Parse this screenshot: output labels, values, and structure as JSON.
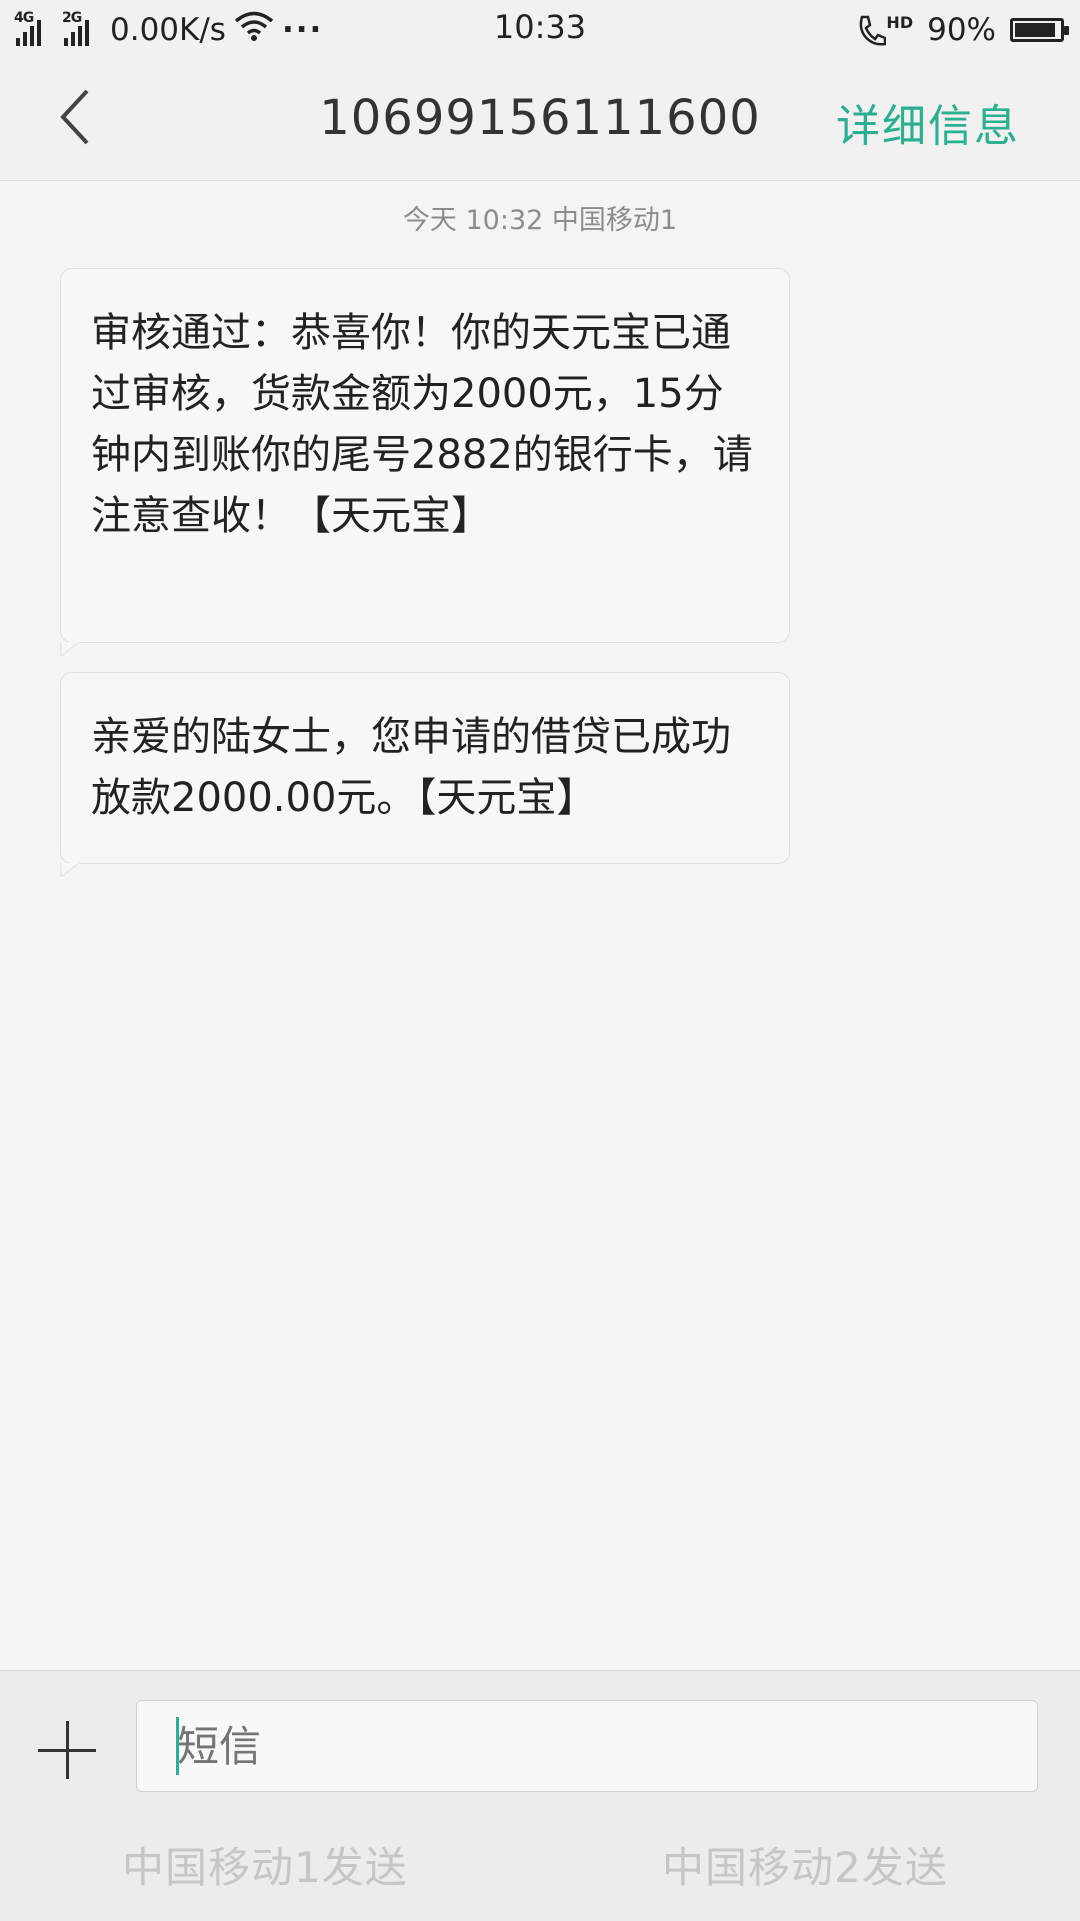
{
  "status_bar": {
    "net1": "4G",
    "net2": "2G",
    "speed": "0.00K/s",
    "more": "···",
    "time": "10:33",
    "call_badge": "HD",
    "battery_text": "90%",
    "battery_level": 0.9
  },
  "header": {
    "title": "10699156111600",
    "detail_label": "详细信息"
  },
  "conversation": {
    "timestamp": "今天  10:32  中国移动1",
    "messages": [
      {
        "text": "审核通过：恭喜你！你的天元宝已通过审核，货款金额为2000元，15分钟内到账你的尾号2882的银行卡，请注意查收！【天元宝】"
      },
      {
        "text": "亲爱的陆女士，您申请的借贷已成功放款2000.00元。【天元宝】"
      }
    ]
  },
  "composer": {
    "placeholder": "短信",
    "send_sim1": "中国移动1发送",
    "send_sim2": "中国移动2发送"
  },
  "colors": {
    "accent": "#2ab08f",
    "background": "#f4f4f4"
  },
  "icons": {
    "back": "chevron-left-icon",
    "attach": "plus-icon",
    "wifi": "wifi-icon",
    "call": "hd-call-icon",
    "battery": "battery-icon"
  }
}
